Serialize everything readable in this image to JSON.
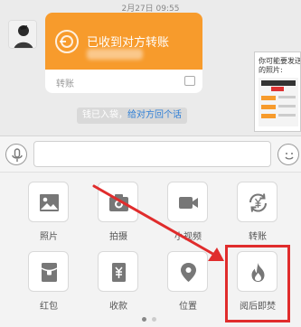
{
  "chat": {
    "timestamp": "2月27日 09:55",
    "transfer": {
      "title": "已收到对方转账",
      "footer_label": "转账"
    },
    "system_message": {
      "text": "钱已入袋，",
      "link_text": "给对方回个话"
    },
    "side_card": {
      "text": "你可能要发送的照片:"
    }
  },
  "input_bar": {
    "placeholder": ""
  },
  "panel": {
    "items": [
      {
        "label": "照片",
        "icon": "photo-icon"
      },
      {
        "label": "拍摄",
        "icon": "camera-icon"
      },
      {
        "label": "小视频",
        "icon": "video-icon"
      },
      {
        "label": "转账",
        "icon": "transfer-icon"
      },
      {
        "label": "红包",
        "icon": "red-packet-icon"
      },
      {
        "label": "收款",
        "icon": "receive-money-icon"
      },
      {
        "label": "位置",
        "icon": "location-icon"
      },
      {
        "label": "阅后即焚",
        "icon": "flame-icon"
      }
    ],
    "page_dots": 2,
    "active_page": 1
  },
  "colors": {
    "transfer_orange": "#f79b2c",
    "link_blue": "#2f7fd6",
    "highlight_red": "#e02c2c",
    "icon_gray": "#777777"
  }
}
